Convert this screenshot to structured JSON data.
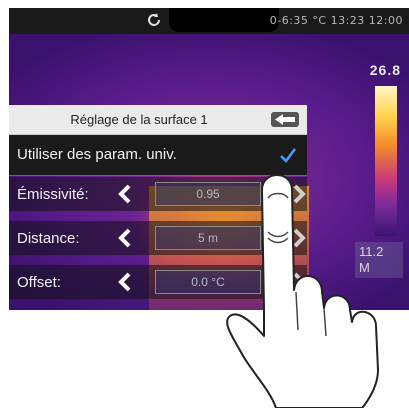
{
  "status_bar": {
    "text": "0-6:35 °C 13:23 12:00"
  },
  "scale": {
    "max_label": "26.8",
    "min_label_1": "11.2",
    "min_label_2": "M"
  },
  "panel": {
    "title": "Réglage de la surface 1",
    "universal_option": {
      "label": "Utiliser des param. univ.",
      "checked": true
    },
    "params": [
      {
        "label": "Émissivité:",
        "value": "0.95"
      },
      {
        "label": "Distance:",
        "value": "5 m"
      },
      {
        "label": "Offset:",
        "value": "0.0 °C"
      }
    ]
  },
  "colors": {
    "panel_header": "#eaeaea",
    "row_dark": "#1a1a1a",
    "check_accent": "#4aa0ff"
  },
  "icons": {
    "back": "back-arrow-icon",
    "check": "check-icon",
    "left": "chevron-left-icon",
    "right": "chevron-right-icon",
    "sync": "sync-icon"
  }
}
